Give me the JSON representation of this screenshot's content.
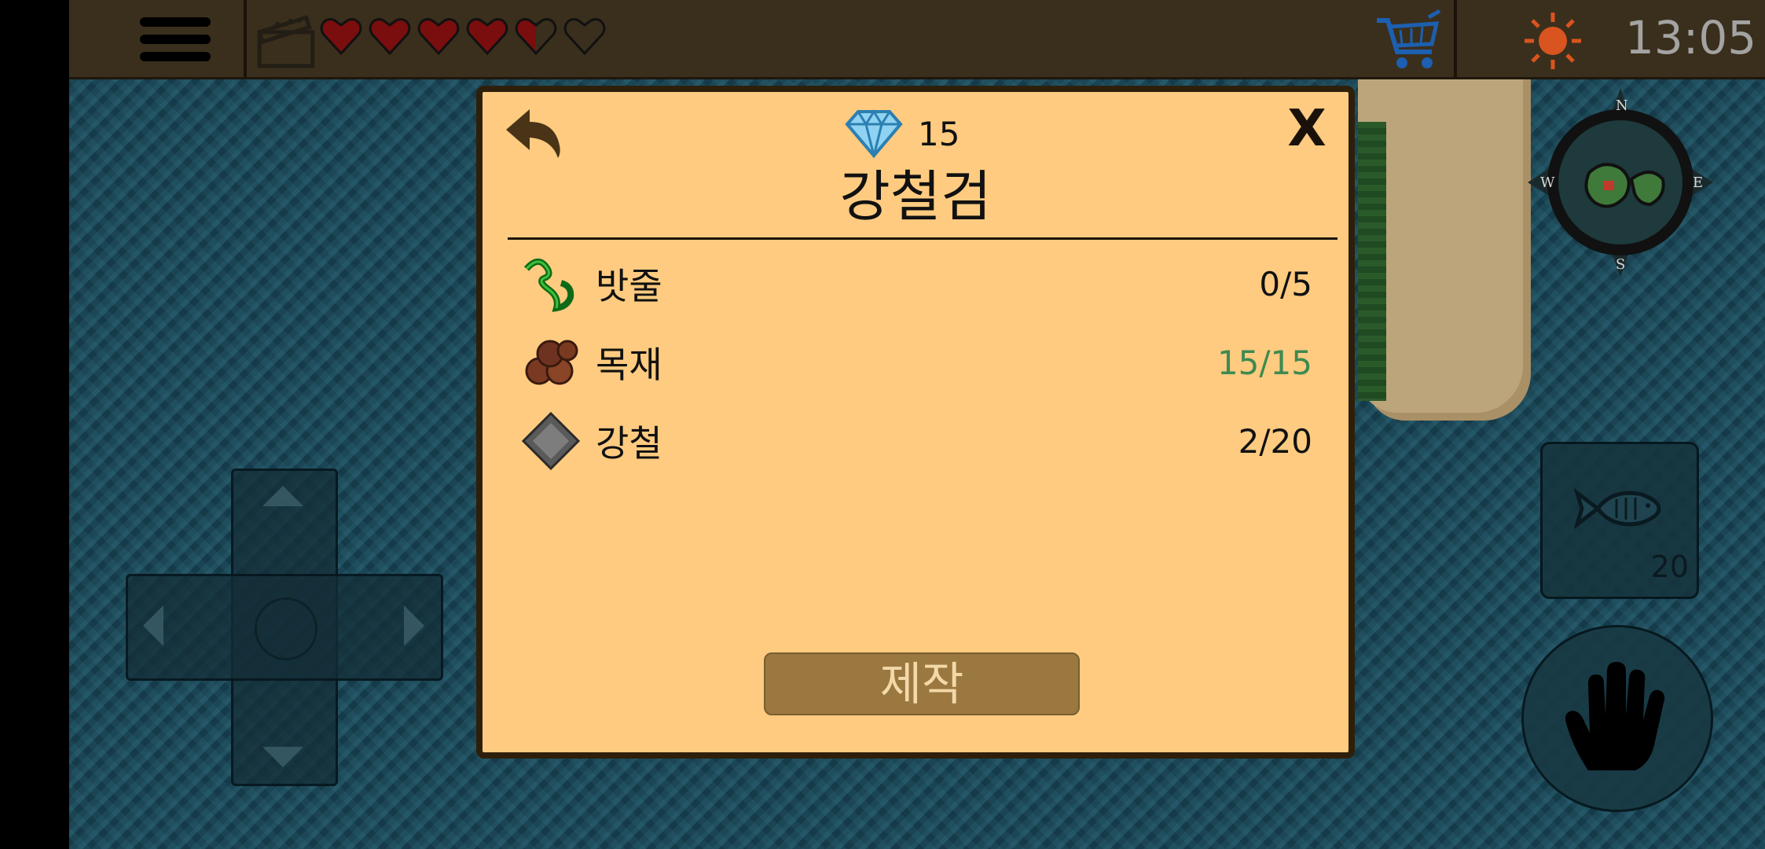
{
  "hud": {
    "time": "13:05",
    "hearts": [
      "full",
      "full",
      "full",
      "full",
      "half",
      "empty"
    ]
  },
  "dialog": {
    "gem_count": "15",
    "title": "강철검",
    "requirements": [
      {
        "name": "밧줄",
        "count": "0/5",
        "icon": "rope-icon",
        "complete": false
      },
      {
        "name": "목재",
        "count": "15/15",
        "icon": "wood-icon",
        "complete": true
      },
      {
        "name": "강철",
        "count": "2/20",
        "icon": "steel-icon",
        "complete": false
      }
    ],
    "close_label": "X",
    "craft_label": "제작"
  },
  "quickslot": {
    "fish_count": "20"
  },
  "colors": {
    "dialog_bg": "#fecb80",
    "complete_green": "#3e8a50",
    "craft_button": "#9a7840",
    "sea": "#1d4756",
    "topbar": "#3a2f1c"
  }
}
